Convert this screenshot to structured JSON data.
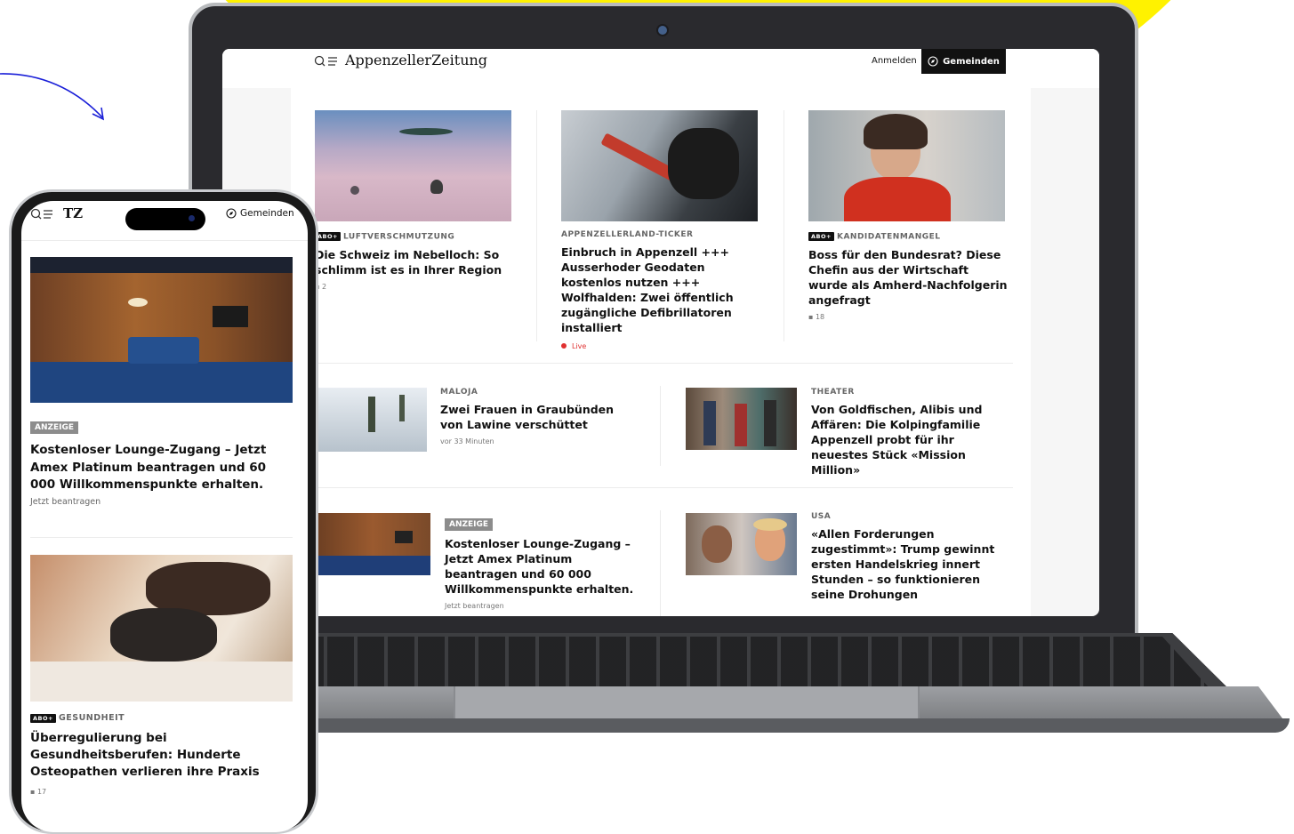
{
  "colors": {
    "yellow": "#fff200",
    "arrow": "#1a1fd8",
    "ink": "#111111",
    "live": "#e03131"
  },
  "laptop": {
    "header": {
      "search_icon": "search-icon",
      "menu_icon": "menu-icon",
      "logo": "AppenzellerZeitung",
      "login": "Anmelden",
      "gemeinden": "Gemeinden",
      "compass_icon": "compass-icon"
    },
    "articles": [
      {
        "badge": "abo+",
        "kicker": "LUFTVERSCHMUTZUNG",
        "title": "Die Schweiz im Nebelloch: So schlimm ist es in Ihrer Region",
        "comments": "2"
      },
      {
        "kicker": "APPENZELLERLAND-TICKER",
        "title": "Einbruch in Appenzell +++ Ausserhoder Geodaten kostenlos nutzen +++ Wolfhalden: Zwei öffentlich zugängliche Defibrillatoren installiert",
        "live": "Live"
      },
      {
        "badge": "abo+",
        "kicker": "KANDIDATENMANGEL",
        "title": "Boss für den Bundesrat? Diese Chefin aus der Wirtschaft wurde als Amherd-Nachfolgerin angefragt",
        "comments": "18"
      },
      {
        "kicker": "MALOJA",
        "title": "Zwei Frauen in Graubünden von Lawine verschüttet",
        "meta": "vor 33 Minuten"
      },
      {
        "kicker": "THEATER",
        "title": "Von Goldfischen, Alibis und Affären: Die Kolpingfamilie Appenzell probt für ihr neuestes Stück «Mission Million»"
      },
      {
        "badge": "ANZEIGE",
        "title": "Kostenloser Lounge-Zugang – Jetzt Amex Platinum beantragen und 60 000 Willkommenspunkte erhalten.",
        "meta": "Jetzt beantragen"
      },
      {
        "kicker": "USA",
        "title": "«Allen Forderungen zugestimmt»: Trump gewinnt ersten Handelskrieg innert Stunden – so funktionieren seine Drohungen"
      }
    ]
  },
  "phone": {
    "header": {
      "logo": "TZ",
      "gemeinden": "Gemeinden"
    },
    "articles": [
      {
        "badge": "ANZEIGE",
        "title": "Kostenloser Lounge-Zugang – Jetzt Amex Platinum beantragen und 60 000 Willkommenspunkte erhalten.",
        "meta": "Jetzt beantragen"
      },
      {
        "badge": "abo+",
        "kicker": "GESUNDHEIT",
        "title": "Überregulierung bei Gesundheitsberufen: Hunderte Osteopathen verlieren ihre Praxis",
        "comments": "17"
      }
    ]
  }
}
